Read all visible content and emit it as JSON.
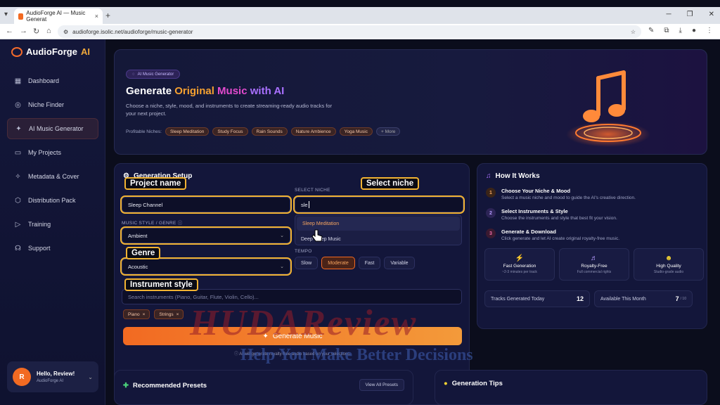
{
  "browser": {
    "tab_title": "AudioForge AI — Music Generat",
    "url": "audioforge.isolic.net/audioforge/music-generator"
  },
  "sidebar": {
    "logo_text": "AudioForge",
    "logo_ai": "AI",
    "items": [
      {
        "label": "Dashboard",
        "icon": "grid-icon"
      },
      {
        "label": "Niche Finder",
        "icon": "compass-icon"
      },
      {
        "label": "AI Music Generator",
        "icon": "wand-icon",
        "active": true
      },
      {
        "label": "My Projects",
        "icon": "folder-icon"
      },
      {
        "label": "Metadata & Cover",
        "icon": "magic-icon"
      },
      {
        "label": "Distribution Pack",
        "icon": "box-icon"
      },
      {
        "label": "Training",
        "icon": "play-circle-icon"
      },
      {
        "label": "Support",
        "icon": "headset-icon"
      }
    ],
    "user": {
      "initial": "R",
      "name": "Hello, Review!",
      "sub": "AudioForge AI"
    }
  },
  "hero": {
    "badge": "AI Music Generator",
    "title_prefix": "Generate ",
    "title_original": "Original ",
    "title_music": "Music ",
    "title_ai": "with AI",
    "description": "Choose a niche, style, mood, and instruments to create streaming-ready audio tracks for your next project.",
    "niches_label": "Profitable Niches:",
    "niches": [
      "Sleep Meditation",
      "Study Focus",
      "Rain Sounds",
      "Nature Ambience",
      "Yoga Music",
      "+ More"
    ]
  },
  "generation": {
    "title": "Generation Setup",
    "project_value": "Sleep Channel",
    "niche_label": "SELECT NICHE",
    "niche_value": "sle",
    "niche_options": [
      "Sleep Meditation",
      "Deep Sleep Music"
    ],
    "style_label": "MUSIC STYLE / GENRE",
    "style_value": "Ambient",
    "instrument_value": "Acoustic",
    "tempo_label": "TEMPO",
    "tempos": [
      "Slow",
      "Moderate",
      "Fast",
      "Variable"
    ],
    "tempo_selected": "Moderate",
    "search_placeholder": "Search instruments (Piano, Guitar, Flute, Violin, Cello)...",
    "tags": [
      "Piano",
      "Strings"
    ],
    "button": "Generate Music",
    "note": "AI will generate royalty-free audio based on your selections."
  },
  "annotations": {
    "project_name": "Project name",
    "select_niche": "Select niche",
    "genre": "Genre",
    "instrument_style": "Instrument style"
  },
  "how": {
    "title": "How It Works",
    "steps": [
      {
        "num": "1",
        "title": "Choose Your Niche & Mood",
        "desc": "Select a music niche and mood to guide the AI's creative direction."
      },
      {
        "num": "2",
        "title": "Select Instruments & Style",
        "desc": "Choose the instruments and style that best fit your vision."
      },
      {
        "num": "3",
        "title": "Generate & Download",
        "desc": "Click generate and let AI create original royalty-free music."
      }
    ],
    "features": [
      {
        "title": "Fast Generation",
        "sub": "~2-3 minutes per track"
      },
      {
        "title": "Royalty-Free",
        "sub": "Full commercial rights"
      },
      {
        "title": "High Quality",
        "sub": "Studio-grade audio"
      }
    ],
    "stat1_label": "Tracks Generated Today",
    "stat1_value": "12",
    "stat2_label": "Available This Month",
    "stat2_value": "7",
    "stat2_total": "/ 10"
  },
  "presets": {
    "title": "Recommended Presets",
    "view_all": "View All Presets"
  },
  "tips": {
    "title": "Generation Tips"
  },
  "watermark": {
    "main": "HUDAReview",
    "sub": "Help You Make Better Decisions"
  },
  "colors": {
    "accent": "#f26a22",
    "highlight": "#f2b332",
    "bg": "#0b0d1c",
    "panel": "#13163a"
  }
}
